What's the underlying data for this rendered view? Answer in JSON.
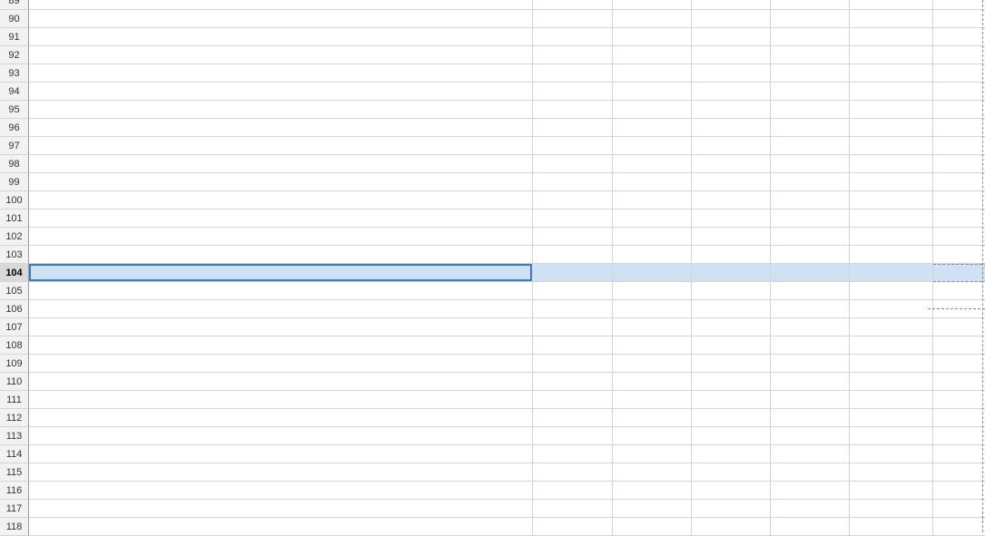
{
  "selected_row": "104",
  "rows": [
    {
      "n": "89",
      "name": "",
      "v": [
        "",
        "",
        "",
        "",
        ""
      ]
    },
    {
      "n": "90",
      "name": "",
      "v": [
        "",
        "",
        "",
        "",
        ""
      ]
    },
    {
      "n": "91",
      "name": "",
      "v": [
        "",
        "",
        "",
        "",
        ""
      ]
    },
    {
      "n": "92",
      "name": "",
      "v": [
        "",
        "",
        "",
        "",
        ""
      ]
    },
    {
      "n": "93",
      "name": "",
      "v": [
        "",
        "",
        "",
        "",
        ""
      ]
    },
    {
      "n": "94",
      "name": "",
      "v": [
        "",
        "",
        "",
        "",
        ""
      ]
    },
    {
      "n": "95",
      "name": "",
      "v": [
        "",
        "",
        "",
        "",
        ""
      ]
    },
    {
      "n": "96",
      "name": "",
      "v": [
        "",
        "",
        "",
        "",
        ""
      ]
    },
    {
      "n": "97",
      "name": "",
      "v": [
        "",
        "",
        "",
        "",
        ""
      ]
    },
    {
      "n": "98",
      "name": "",
      "v": [
        "",
        "",
        "",
        "",
        ""
      ]
    },
    {
      "n": "99",
      "name": "",
      "v": [
        "",
        "",
        "",
        "",
        ""
      ]
    },
    {
      "n": "100",
      "name": "",
      "v": [
        "",
        "",
        "",
        "",
        ""
      ]
    },
    {
      "n": "101",
      "name": "",
      "v": [
        "",
        "",
        "",
        "",
        ""
      ]
    },
    {
      "n": "102",
      "name": "",
      "v": [
        "",
        "",
        "",
        "",
        ""
      ]
    },
    {
      "n": "103",
      "name": "",
      "v": [
        "",
        "",
        "",
        "",
        ""
      ]
    },
    {
      "n": "104",
      "name": "",
      "v": [
        "",
        "",
        "",
        "",
        ""
      ]
    },
    {
      "n": "105",
      "name": "",
      "v": [
        "",
        "",
        "",
        "",
        ""
      ]
    },
    {
      "n": "106",
      "name": "",
      "v": [
        "",
        "",
        "",
        "",
        ""
      ]
    },
    {
      "n": "107",
      "name": "",
      "v": [
        "",
        "",
        "",
        "",
        ""
      ]
    },
    {
      "n": "108",
      "name": "",
      "v": [
        "",
        "",
        "",
        "",
        ""
      ]
    },
    {
      "n": "109",
      "name": "",
      "v": [
        "",
        "",
        "",
        "",
        ""
      ]
    },
    {
      "n": "110",
      "name": "",
      "v": [
        "",
        "",
        "",
        "",
        ""
      ]
    },
    {
      "n": "111",
      "name": "",
      "v": [
        "",
        "",
        "",
        "",
        ""
      ]
    },
    {
      "n": "112",
      "name": "",
      "v": [
        "",
        "",
        "",
        "",
        ""
      ]
    },
    {
      "n": "113",
      "name": "",
      "v": [
        "",
        "",
        "",
        "",
        ""
      ]
    },
    {
      "n": "114",
      "name": "",
      "v": [
        "",
        "",
        "",
        "",
        ""
      ]
    },
    {
      "n": "115",
      "name": "",
      "v": [
        "",
        "",
        "",
        "",
        ""
      ]
    },
    {
      "n": "116",
      "name": "",
      "v": [
        "",
        "",
        "",
        "",
        ""
      ]
    },
    {
      "n": "117",
      "name": "",
      "v": [
        "",
        "",
        "",
        "",
        ""
      ]
    },
    {
      "n": "118",
      "name": "",
      "v": [
        "",
        "",
        "",
        "",
        ""
      ]
    }
  ]
}
